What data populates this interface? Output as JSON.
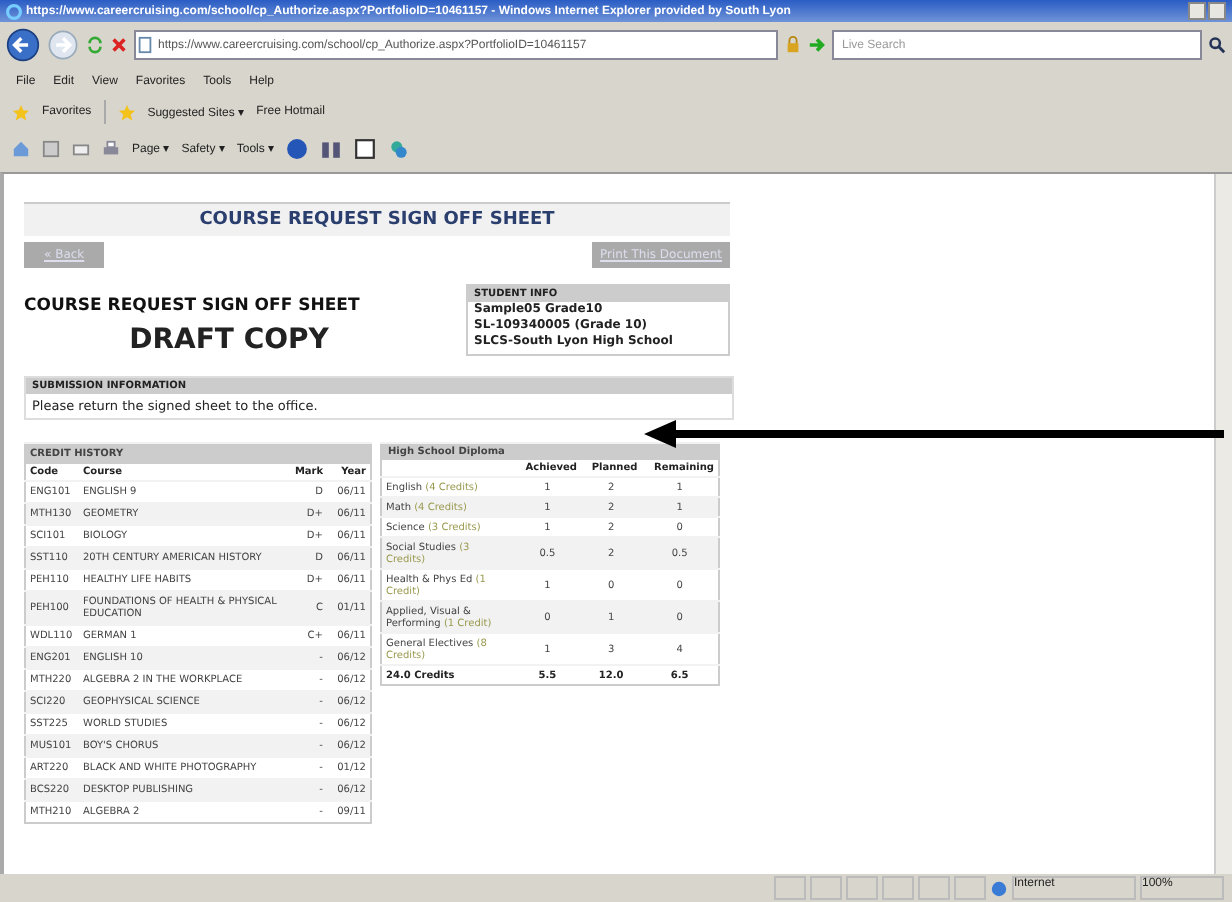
{
  "window": {
    "title": "https://www.careercruising.com/school/cp_Authorize.aspx?PortfolioID=10461157 - Windows Internet Explorer provided by South Lyon"
  },
  "address": {
    "value": "https://www.careercruising.com/school/cp_Authorize.aspx?PortfolioID=10461157"
  },
  "search": {
    "placeholder": "Live Search"
  },
  "menu": [
    "File",
    "Edit",
    "View",
    "Favorites",
    "Tools",
    "Help"
  ],
  "favorites_bar": {
    "favorites": "Favorites",
    "items": [
      "Suggested Sites ▾",
      "Free Hotmail"
    ]
  },
  "command_bar": [
    "Page ▾",
    "Safety ▾",
    "Tools ▾"
  ],
  "page": {
    "banner": "COURSE REQUEST SIGN OFF SHEET",
    "back": "« Back",
    "print": "Print This Document",
    "heading": "COURSE REQUEST SIGN OFF SHEET",
    "draft": "DRAFT COPY",
    "student_info": {
      "title": "STUDENT INFO",
      "lines": [
        "Sample05 Grade10",
        "SL-109340005 (Grade 10)",
        "SLCS-South Lyon High School"
      ]
    },
    "submission": {
      "title": "SUBMISSION INFORMATION",
      "text": "Please return the signed sheet to the office."
    },
    "credit_history": {
      "title": "CREDIT HISTORY",
      "columns": [
        "Code",
        "Course",
        "Mark",
        "Year"
      ],
      "rows": [
        [
          "ENG101",
          "ENGLISH 9",
          "D",
          "06/11"
        ],
        [
          "MTH130",
          "GEOMETRY",
          "D+",
          "06/11"
        ],
        [
          "SCI101",
          "BIOLOGY",
          "D+",
          "06/11"
        ],
        [
          "SST110",
          "20TH CENTURY AMERICAN HISTORY",
          "D",
          "06/11"
        ],
        [
          "PEH110",
          "HEALTHY LIFE HABITS",
          "D+",
          "06/11"
        ],
        [
          "PEH100",
          "FOUNDATIONS OF HEALTH & PHYSICAL EDUCATION",
          "C",
          "01/11"
        ],
        [
          "WDL110",
          "GERMAN 1",
          "C+",
          "06/11"
        ],
        [
          "ENG201",
          "ENGLISH 10",
          "-",
          "06/12"
        ],
        [
          "MTH220",
          "ALGEBRA 2 IN THE WORKPLACE",
          "-",
          "06/12"
        ],
        [
          "SCI220",
          "GEOPHYSICAL SCIENCE",
          "-",
          "06/12"
        ],
        [
          "SST225",
          "WORLD STUDIES",
          "-",
          "06/12"
        ],
        [
          "MUS101",
          "BOY'S CHORUS",
          "-",
          "06/12"
        ],
        [
          "ART220",
          "BLACK AND WHITE PHOTOGRAPHY",
          "-",
          "01/12"
        ],
        [
          "BCS220",
          "DESKTOP PUBLISHING",
          "-",
          "06/12"
        ],
        [
          "MTH210",
          "ALGEBRA 2",
          "-",
          "09/11"
        ]
      ]
    },
    "diploma": {
      "title": "High School Diploma",
      "columns": [
        "Achieved",
        "Planned",
        "Remaining"
      ],
      "rows": [
        {
          "name": "English",
          "credits": "(4 Credits)",
          "values": [
            "1",
            "2",
            "1"
          ]
        },
        {
          "name": "Math",
          "credits": "(4 Credits)",
          "values": [
            "1",
            "2",
            "1"
          ]
        },
        {
          "name": "Science",
          "credits": "(3 Credits)",
          "values": [
            "1",
            "2",
            "0"
          ]
        },
        {
          "name": "Social Studies",
          "credits": "(3 Credits)",
          "values": [
            "0.5",
            "2",
            "0.5"
          ]
        },
        {
          "name": "Health & Phys Ed",
          "credits": "(1 Credit)",
          "values": [
            "1",
            "0",
            "0"
          ]
        },
        {
          "name": "Applied, Visual & Performing",
          "credits": "(1 Credit)",
          "values": [
            "0",
            "1",
            "0"
          ]
        },
        {
          "name": "General Electives",
          "credits": "(8 Credits)",
          "values": [
            "1",
            "3",
            "4"
          ]
        }
      ],
      "total": {
        "label": "24.0 Credits",
        "values": [
          "5.5",
          "12.0",
          "6.5"
        ]
      }
    }
  },
  "status_bar": {
    "zone": "Internet",
    "zoom": "100%"
  }
}
